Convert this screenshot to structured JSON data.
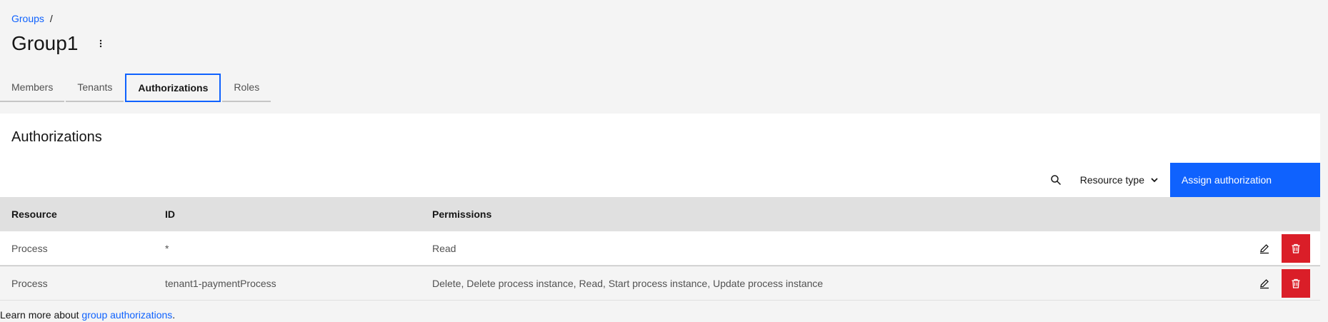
{
  "breadcrumb": {
    "parent_label": "Groups",
    "separator": "/"
  },
  "page": {
    "title": "Group1",
    "overflow_icon": "overflow-menu-vertical-icon"
  },
  "tabs": [
    {
      "label": "Members",
      "active": false
    },
    {
      "label": "Tenants",
      "active": false
    },
    {
      "label": "Authorizations",
      "active": true
    },
    {
      "label": "Roles",
      "active": false
    }
  ],
  "authorizations": {
    "title": "Authorizations",
    "toolbar": {
      "search_icon": "search-icon",
      "filter_label": "Resource type",
      "filter_icon": "chevron-down-icon",
      "assign_button_label": "Assign authorization"
    },
    "table": {
      "headers": [
        "Resource",
        "ID",
        "Permissions"
      ],
      "rows": [
        {
          "resource": "Process",
          "id": "*",
          "permissions": "Read"
        },
        {
          "resource": "Process",
          "id": "tenant1-paymentProcess",
          "permissions": "Delete, Delete process instance, Read, Start process instance, Update process instance"
        }
      ],
      "edit_icon": "edit-icon",
      "delete_icon": "trash-can-icon"
    }
  },
  "footer": {
    "prefix": "Learn more about",
    "link_label": "group authorizations",
    "suffix": "."
  },
  "colors": {
    "background": "#f4f4f4",
    "surface": "#ffffff",
    "primary": "#0f62fe",
    "danger": "#da1e28",
    "header_row": "#e0e0e0",
    "text_primary": "#161616",
    "text_secondary": "#525252"
  }
}
